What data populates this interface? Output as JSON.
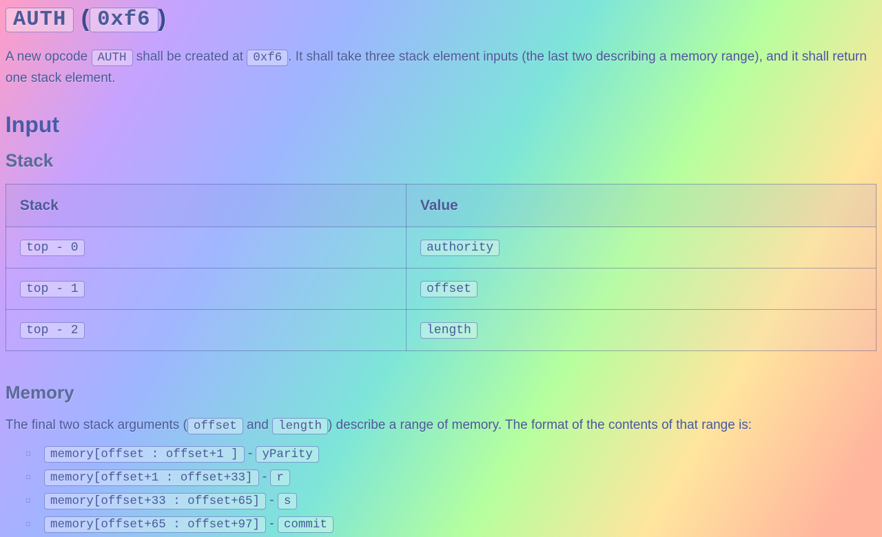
{
  "heading": {
    "opcode": "AUTH",
    "lparen": " (",
    "hex": "0xf6",
    "rparen": ")"
  },
  "intro": {
    "t1": "A new opcode ",
    "c1": "AUTH",
    "t2": " shall be created at ",
    "c2": "0xf6",
    "t3": ". It shall take three stack element inputs (the last two describing a memory range), and it shall return one stack element."
  },
  "sections": {
    "input": "Input",
    "stack": "Stack",
    "memory": "Memory"
  },
  "table": {
    "headers": {
      "stack": "Stack",
      "value": "Value"
    },
    "rows": [
      {
        "stack": "top - 0",
        "value": "authority"
      },
      {
        "stack": "top - 1",
        "value": "offset"
      },
      {
        "stack": "top - 2",
        "value": "length"
      }
    ]
  },
  "mem_para": {
    "t1": "The final two stack arguments (",
    "c1": "offset",
    "t2": " and ",
    "c2": "length",
    "t3": ") describe a range of memory. The format of the contents of that range is:"
  },
  "mem_list": [
    {
      "range": "memory[offset : offset+1 ]",
      "sep": " - ",
      "val": "yParity"
    },
    {
      "range": "memory[offset+1 : offset+33]",
      "sep": " - ",
      "val": "r"
    },
    {
      "range": "memory[offset+33 : offset+65]",
      "sep": " - ",
      "val": "s"
    },
    {
      "range": "memory[offset+65 : offset+97]",
      "sep": " - ",
      "val": "commit"
    }
  ]
}
